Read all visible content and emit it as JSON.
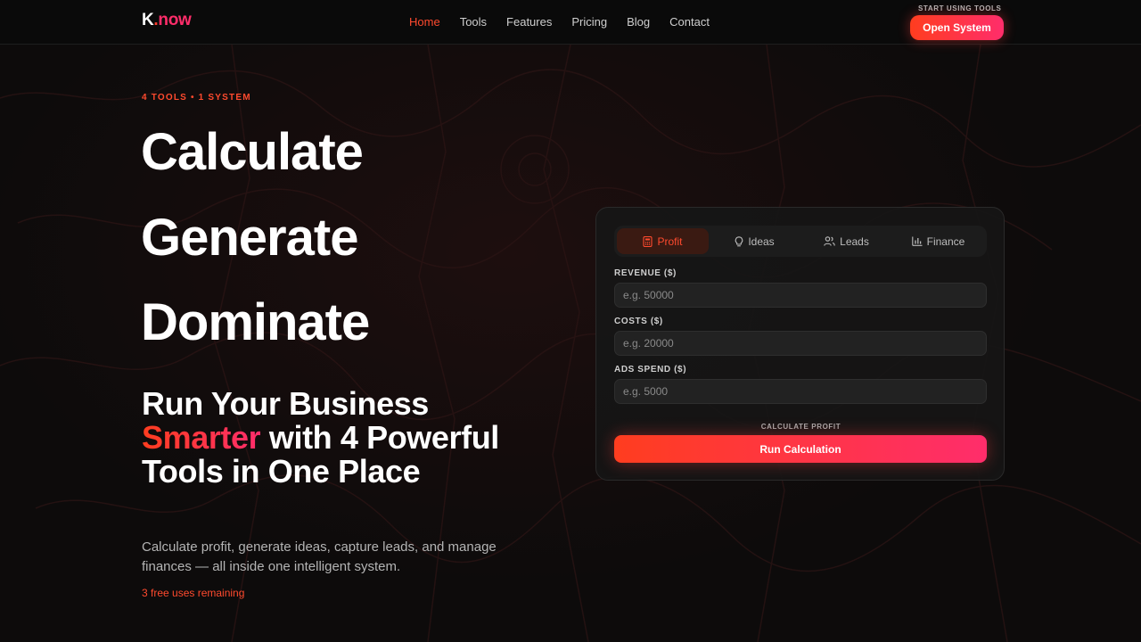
{
  "header": {
    "logo": {
      "k": "K",
      "dot": ".",
      "now": "now"
    },
    "nav": [
      "Home",
      "Tools",
      "Features",
      "Pricing",
      "Blog",
      "Contact"
    ],
    "active_nav": "Home",
    "cta_label": "START USING TOOLS",
    "cta_button": "Open System"
  },
  "hero": {
    "eyebrow": "4 TOOLS • 1 SYSTEM",
    "words": [
      "Calculate",
      "Generate",
      "Dominate"
    ],
    "headline_pre": "Run Your Business",
    "headline_accent": "Smarter",
    "headline_post": "with 4 Powerful Tools in One Place",
    "subtitle": "Calculate profit, generate ideas, capture leads, and manage finances — all inside one intelligent system.",
    "uses_remaining": "3 free uses remaining"
  },
  "card": {
    "tabs": [
      {
        "label": "Profit",
        "icon": "calculator-icon"
      },
      {
        "label": "Ideas",
        "icon": "lightbulb-icon"
      },
      {
        "label": "Leads",
        "icon": "users-icon"
      },
      {
        "label": "Finance",
        "icon": "bar-chart-icon"
      }
    ],
    "active_tab": "Profit",
    "fields": [
      {
        "label": "REVENUE ($)",
        "placeholder": "e.g. 50000",
        "value": ""
      },
      {
        "label": "COSTS ($)",
        "placeholder": "e.g. 20000",
        "value": ""
      },
      {
        "label": "ADS SPEND ($)",
        "placeholder": "e.g. 5000",
        "value": ""
      }
    ],
    "calc_label": "CALCULATE PROFIT",
    "run_button": "Run Calculation"
  },
  "colors": {
    "accent_start": "#ff3d1f",
    "accent_end": "#ff2d6b",
    "background": "#0c0c0c"
  }
}
